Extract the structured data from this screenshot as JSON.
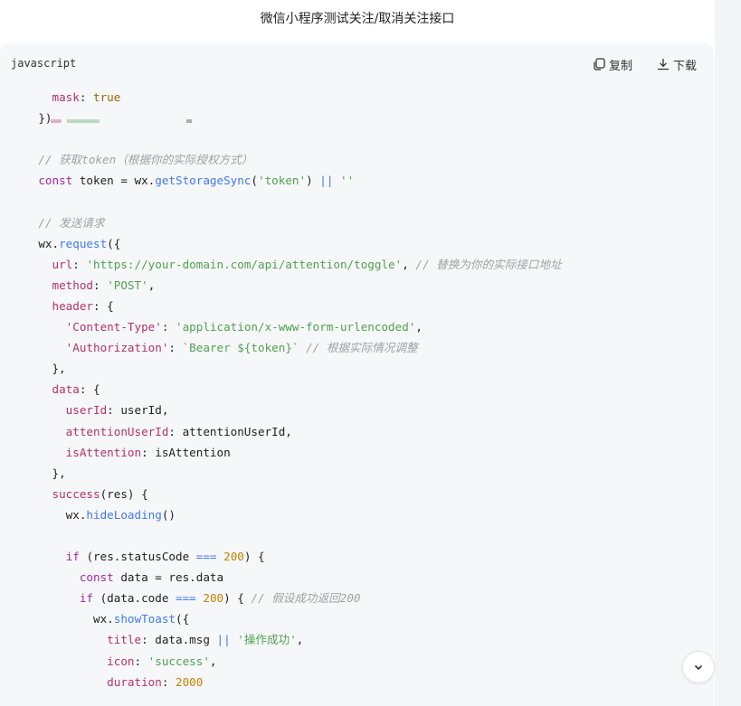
{
  "page": {
    "title": "微信小程序测试关注/取消关注接口"
  },
  "code_block": {
    "language": "javascript",
    "copy_label": "复制",
    "download_label": "下载"
  },
  "code_lines": [
    [
      [
        "  mask",
        "p"
      ],
      [
        ": ",
        ""
      ],
      [
        "true",
        "b"
      ]
    ],
    [
      [
        "})",
        ""
      ]
    ],
    [
      [
        "",
        ""
      ]
    ],
    [
      [
        "// 获取token（根据你的实际授权方式）",
        "c"
      ]
    ],
    [
      [
        "const",
        "k"
      ],
      [
        " token = wx.",
        ""
      ],
      [
        "getStorageSync",
        "f"
      ],
      [
        "(",
        ""
      ],
      [
        "'token'",
        "s"
      ],
      [
        ") ",
        ""
      ],
      [
        "||",
        "o"
      ],
      [
        " ",
        ""
      ],
      [
        "''",
        "s"
      ]
    ],
    [
      [
        "",
        ""
      ]
    ],
    [
      [
        "// 发送请求",
        "c"
      ]
    ],
    [
      [
        "wx.",
        ""
      ],
      [
        "request",
        "f"
      ],
      [
        "({",
        ""
      ]
    ],
    [
      [
        "  url",
        "p"
      ],
      [
        ": ",
        ""
      ],
      [
        "'https://your-domain.com/api/attention/toggle'",
        "s"
      ],
      [
        ", ",
        ""
      ],
      [
        "// 替换为你的实际接口地址",
        "c"
      ]
    ],
    [
      [
        "  method",
        "p"
      ],
      [
        ": ",
        ""
      ],
      [
        "'POST'",
        "s"
      ],
      [
        ",",
        ""
      ]
    ],
    [
      [
        "  header",
        "p"
      ],
      [
        ": {",
        ""
      ]
    ],
    [
      [
        "    'Content-Type'",
        "p"
      ],
      [
        ": ",
        ""
      ],
      [
        "'application/x-www-form-urlencoded'",
        "s"
      ],
      [
        ",",
        ""
      ]
    ],
    [
      [
        "    'Authorization'",
        "p"
      ],
      [
        ": ",
        ""
      ],
      [
        "`Bearer ${token}`",
        "s"
      ],
      [
        " ",
        ""
      ],
      [
        "// 根据实际情况调整",
        "c"
      ]
    ],
    [
      [
        "  },",
        ""
      ]
    ],
    [
      [
        "  data",
        "p"
      ],
      [
        ": {",
        ""
      ]
    ],
    [
      [
        "    userId",
        "p"
      ],
      [
        ": userId,",
        ""
      ]
    ],
    [
      [
        "    attentionUserId",
        "p"
      ],
      [
        ": attentionUserId,",
        ""
      ]
    ],
    [
      [
        "    isAttention",
        "p"
      ],
      [
        ": isAttention",
        ""
      ]
    ],
    [
      [
        "  },",
        ""
      ]
    ],
    [
      [
        "  success",
        "p"
      ],
      [
        "(res) {",
        ""
      ]
    ],
    [
      [
        "    wx.",
        ""
      ],
      [
        "hideLoading",
        "f"
      ],
      [
        "()",
        ""
      ]
    ],
    [
      [
        "",
        ""
      ]
    ],
    [
      [
        "    ",
        ""
      ],
      [
        "if",
        "k"
      ],
      [
        " (res.statusCode ",
        ""
      ],
      [
        "===",
        "o"
      ],
      [
        " ",
        ""
      ],
      [
        "200",
        "n"
      ],
      [
        ") {",
        ""
      ]
    ],
    [
      [
        "      ",
        ""
      ],
      [
        "const",
        "k"
      ],
      [
        " data = res.data",
        ""
      ]
    ],
    [
      [
        "      ",
        ""
      ],
      [
        "if",
        "k"
      ],
      [
        " (data.code ",
        ""
      ],
      [
        "===",
        "o"
      ],
      [
        " ",
        ""
      ],
      [
        "200",
        "n"
      ],
      [
        ") { ",
        ""
      ],
      [
        "// 假设成功返回200",
        "c"
      ]
    ],
    [
      [
        "        wx.",
        ""
      ],
      [
        "showToast",
        "f"
      ],
      [
        "({",
        ""
      ]
    ],
    [
      [
        "          title",
        "p"
      ],
      [
        ": data.msg ",
        ""
      ],
      [
        "||",
        "o"
      ],
      [
        " ",
        ""
      ],
      [
        "'操作成功'",
        "s"
      ],
      [
        ",",
        ""
      ]
    ],
    [
      [
        "          icon",
        "p"
      ],
      [
        ": ",
        ""
      ],
      [
        "'success'",
        "s"
      ],
      [
        ",",
        ""
      ]
    ],
    [
      [
        "          duration",
        "p"
      ],
      [
        ": ",
        ""
      ],
      [
        "2000",
        "n"
      ]
    ]
  ],
  "colors": {
    "panel_bg": "#f6f7f9",
    "keyword": "#a626a4",
    "property": "#b5306a",
    "function": "#4078f2",
    "string": "#50a14f",
    "comment": "#a0a1a7",
    "number": "#c18401"
  },
  "icons": {
    "copy": "copy-icon",
    "download": "download-icon",
    "scroll_down": "chevron-down-icon"
  }
}
